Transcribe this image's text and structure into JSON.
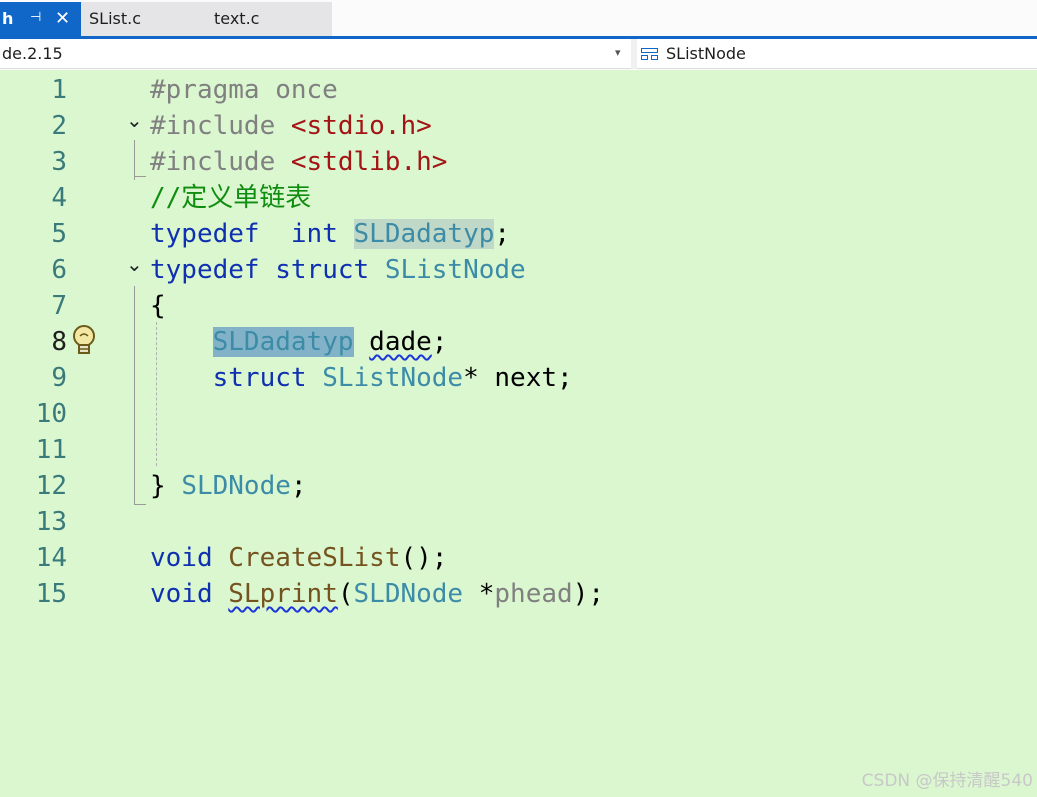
{
  "tabs": {
    "active": {
      "name": "h",
      "pin": "⊣",
      "close": "✕"
    },
    "others": [
      {
        "name": "SList.c"
      },
      {
        "name": "text.c"
      }
    ]
  },
  "navbar": {
    "scope": "de.2.15",
    "dropdown": "▾",
    "member": "SListNode",
    "member_icon": "struct-icon"
  },
  "editor": {
    "current_line": 8,
    "lines": [
      {
        "n": "1"
      },
      {
        "n": "2"
      },
      {
        "n": "3"
      },
      {
        "n": "4"
      },
      {
        "n": "5"
      },
      {
        "n": "6"
      },
      {
        "n": "7"
      },
      {
        "n": "8"
      },
      {
        "n": "9"
      },
      {
        "n": "10"
      },
      {
        "n": "11"
      },
      {
        "n": "12"
      },
      {
        "n": "13"
      },
      {
        "n": "14"
      },
      {
        "n": "15"
      }
    ],
    "tokens": {
      "l1": "#pragma once",
      "l2_pp": "#include ",
      "l2_str": "<stdio.h>",
      "l3_pp": "#include ",
      "l3_str": "<stdlib.h>",
      "l4": "//定义单链表",
      "l5_kw1": "typedef",
      "l5_kw2": "int",
      "l5_ty": "SLDadatyp",
      "l5_end": ";",
      "l6_kw1": "typedef",
      "l6_kw2": "struct",
      "l6_ty": "SListNode",
      "l7": "{",
      "l8_ty": "SLDadatyp",
      "l8_id": "dade",
      "l8_end": ";",
      "l9_kw": "struct",
      "l9_ty": "SListNode",
      "l9_rest": "* next;",
      "l12_brace": "}",
      "l12_ty": "SLDNode",
      "l12_end": ";",
      "l14_kw": "void",
      "l14_fn": "CreateSList",
      "l14_end": "();",
      "l15_kw": "void",
      "l15_fn": "SLprint",
      "l15_open": "(",
      "l15_ty": "SLDNode",
      "l15_star": "*",
      "l15_prm": "phead",
      "l15_end": ");"
    },
    "fold_glyph": "⌄"
  },
  "watermark": "CSDN @保持清醒540",
  "colors": {
    "editor_bg": "#dbf7d0",
    "accent": "#1167c8",
    "keyword": "#0f30b0",
    "type": "#3c8ca8",
    "string": "#a31515",
    "comment": "#108d10",
    "function": "#74531f"
  }
}
